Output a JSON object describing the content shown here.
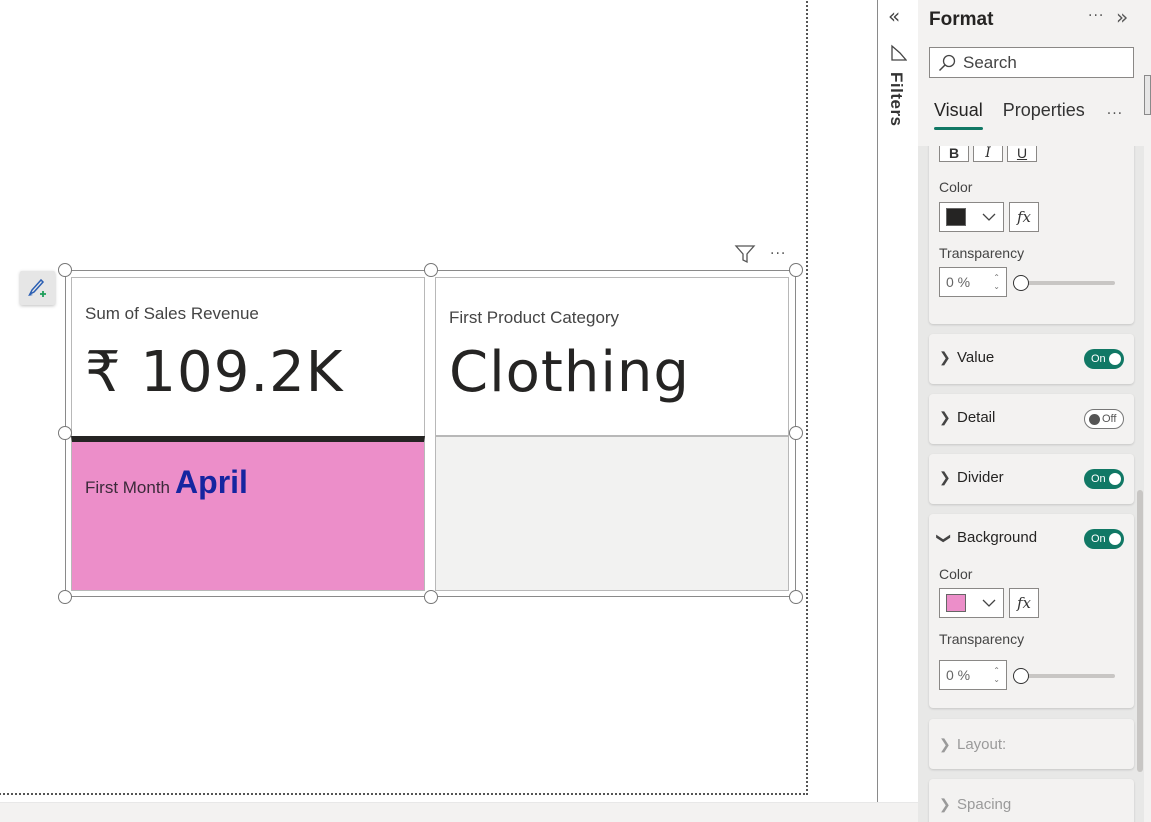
{
  "canvas": {
    "visual": {
      "header_icons": [
        "filter-icon",
        "more-options-icon"
      ],
      "cards": [
        {
          "label": "Sum of Sales Revenue",
          "value": "₹ 109.2K",
          "background": "#ffffff"
        },
        {
          "label": "First Product Category",
          "value": "Clothing",
          "background": "#ffffff"
        },
        {
          "label": "First Month",
          "value": "April",
          "background": "#ec8ec9",
          "value_color": "#1525a0"
        },
        {
          "label": "",
          "value": "",
          "background": "#f2f2f1"
        }
      ],
      "divider_color": "#252423"
    }
  },
  "filters_rail": {
    "collapse_icon": "«",
    "label": "Filters"
  },
  "format_pane": {
    "title": "Format",
    "more": "···",
    "expand_icon": "»",
    "search_placeholder": "Search",
    "tabs": [
      {
        "label": "Visual",
        "active": true
      },
      {
        "label": "Properties",
        "active": false
      }
    ],
    "tabs_more": "···",
    "font_section": {
      "buttons": [
        "B",
        "I",
        "U"
      ],
      "color_label": "Color",
      "color_value": "#252423",
      "fx_label": "fx",
      "transparency_label": "Transparency",
      "transparency_value": "0 %",
      "transparency_percent": 0
    },
    "sections": [
      {
        "label": "Value",
        "toggle": "On",
        "on": true,
        "expanded": false
      },
      {
        "label": "Detail",
        "toggle": "Off",
        "on": false,
        "expanded": false
      },
      {
        "label": "Divider",
        "toggle": "On",
        "on": true,
        "expanded": false
      },
      {
        "label": "Background",
        "toggle": "On",
        "on": true,
        "expanded": true
      },
      {
        "label": "Layout:",
        "disabled": true,
        "expanded": false
      },
      {
        "label": "Spacing",
        "disabled": true,
        "expanded": false
      }
    ],
    "background_section": {
      "color_label": "Color",
      "color_value": "#ec8ec9",
      "fx_label": "fx",
      "transparency_label": "Transparency",
      "transparency_value": "0 %",
      "transparency_percent": 0
    },
    "accent": "#117865"
  }
}
